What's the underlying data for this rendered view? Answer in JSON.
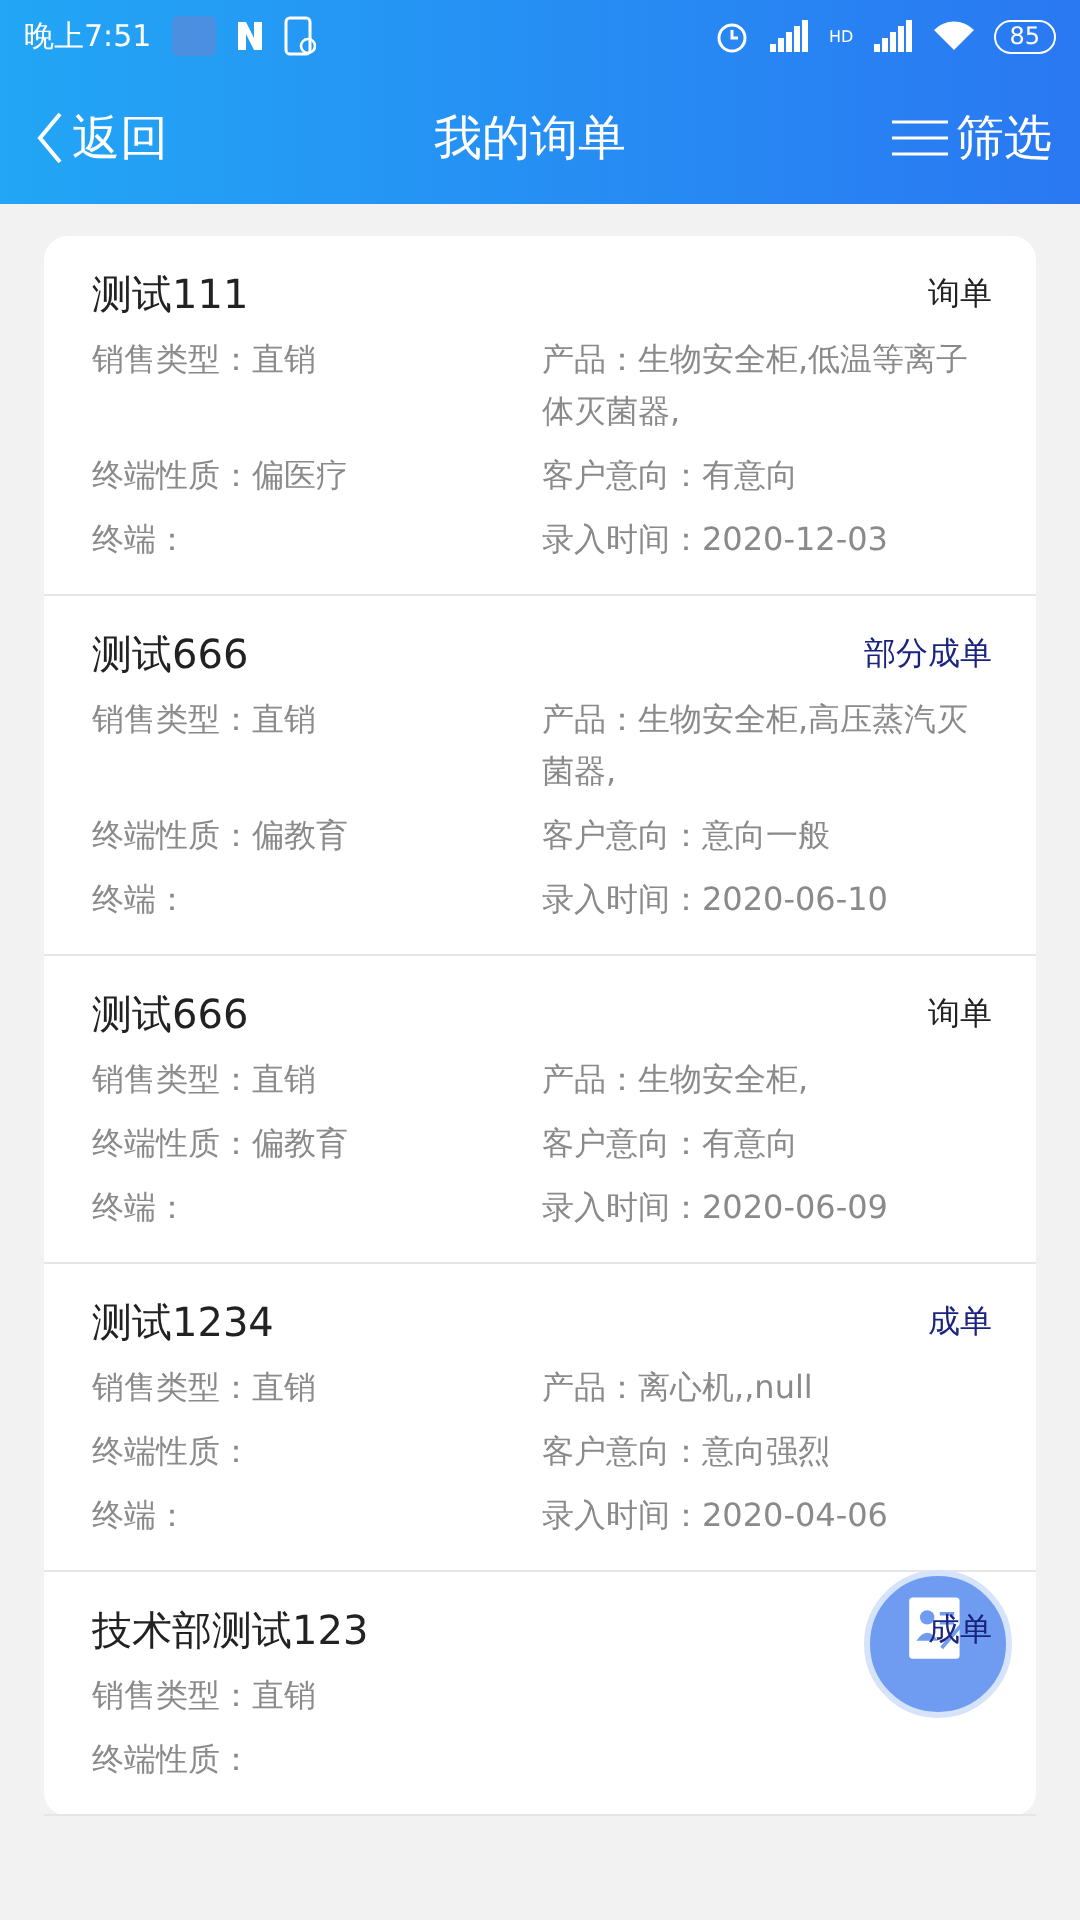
{
  "status_bar": {
    "time": "晚上7:51",
    "battery": "85",
    "signal_label": "HD"
  },
  "header": {
    "back": "返回",
    "title": "我的询单",
    "filter": "筛选"
  },
  "cards": [
    {
      "title": "测试111",
      "status": "询单",
      "kind": "inquiry",
      "rows": [
        {
          "left": "销售类型：直销",
          "right": "产品：生物安全柜,低温等离子体灭菌器,"
        },
        {
          "left": "终端性质：偏医疗",
          "right": "客户意向：有意向"
        },
        {
          "left": "终端：",
          "right": "录入时间：2020-12-03"
        }
      ]
    },
    {
      "title": "测试666",
      "status": "部分成单",
      "kind": "deal",
      "rows": [
        {
          "left": "销售类型：直销",
          "right": "产品：生物安全柜,高压蒸汽灭菌器,"
        },
        {
          "left": "终端性质：偏教育",
          "right": "客户意向：意向一般"
        },
        {
          "left": "终端：",
          "right": "录入时间：2020-06-10"
        }
      ]
    },
    {
      "title": "测试666",
      "status": "询单",
      "kind": "inquiry",
      "rows": [
        {
          "left": "销售类型：直销",
          "right": "产品：生物安全柜,"
        },
        {
          "left": "终端性质：偏教育",
          "right": "客户意向：有意向"
        },
        {
          "left": "终端：",
          "right": "录入时间：2020-06-09"
        }
      ]
    },
    {
      "title": "测试1234",
      "status": "成单",
      "kind": "deal",
      "rows": [
        {
          "left": "销售类型：直销",
          "right": "产品：离心机,,null"
        },
        {
          "left": "终端性质：",
          "right": "客户意向：意向强烈"
        },
        {
          "left": "终端：",
          "right": "录入时间：2020-04-06"
        }
      ]
    },
    {
      "title": "技术部测试123",
      "status": "成单",
      "kind": "deal",
      "rows": [
        {
          "left": "销售类型：直销"
        },
        {
          "left": "终端性质："
        }
      ]
    }
  ]
}
